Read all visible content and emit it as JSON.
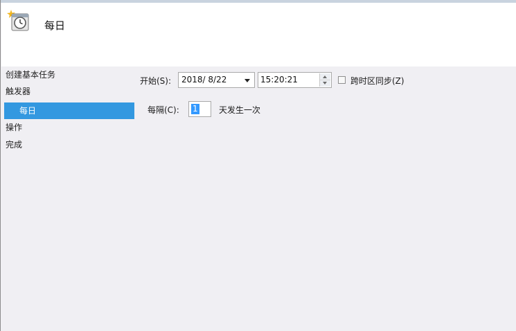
{
  "wizard": {
    "title": "每日"
  },
  "nav": {
    "items": [
      {
        "label": "创建基本任务"
      },
      {
        "label": "触发器"
      },
      {
        "label": "每日",
        "selected": true
      },
      {
        "label": "操作"
      },
      {
        "label": "完成"
      }
    ]
  },
  "form": {
    "start_label": "开始(S):",
    "start_date": "2018/ 8/22",
    "start_time": "15:20:21",
    "timezone_sync_label": "跨时区同步(Z)",
    "timezone_sync_checked": false,
    "interval_label": "每隔(C):",
    "interval_value": "1",
    "interval_suffix": "天发生一次"
  },
  "colors": {
    "selection": "#3398e0",
    "header_bg": "#ffffff",
    "body_bg": "#f0eff3"
  },
  "icons": {
    "wizard": "calendar-clock-icon",
    "date_dropdown": "chevron-down-icon",
    "time_spinner": "spinner-icon"
  }
}
